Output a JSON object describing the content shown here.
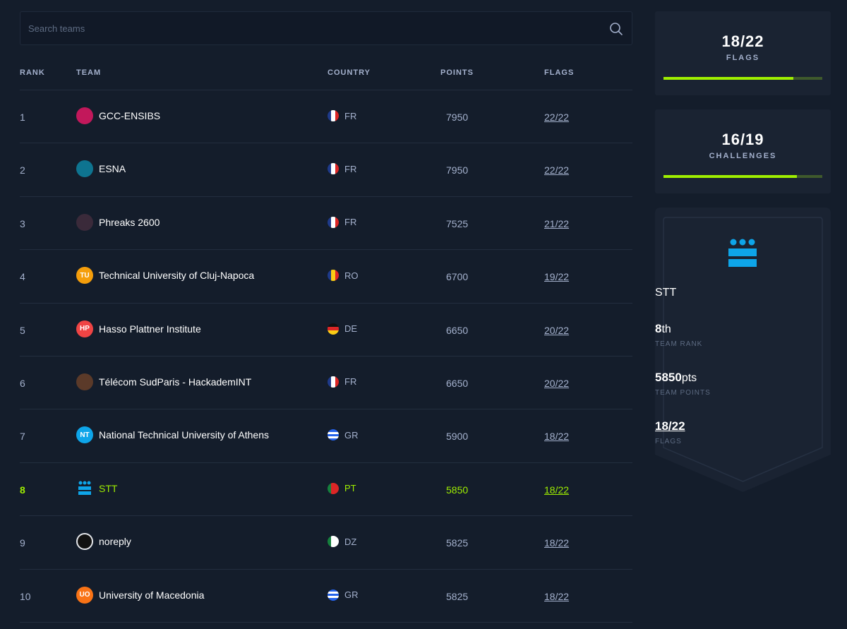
{
  "search": {
    "placeholder": "Search teams"
  },
  "table": {
    "headers": {
      "rank": "RANK",
      "team": "TEAM",
      "country": "COUNTRY",
      "points": "POINTS",
      "flags": "FLAGS"
    },
    "rows": [
      {
        "rank": "1",
        "team": "GCC-ENSIBS",
        "avatar_text": "",
        "avatar_color": "#c2185b",
        "country": "FR",
        "flag": "fr",
        "points": "7950",
        "flags": "22/22"
      },
      {
        "rank": "2",
        "team": "ESNA",
        "avatar_text": "",
        "avatar_color": "#0e7490",
        "country": "FR",
        "flag": "fr",
        "points": "7950",
        "flags": "22/22"
      },
      {
        "rank": "3",
        "team": "Phreaks 2600",
        "avatar_text": "",
        "avatar_color": "#3a2a3a",
        "country": "FR",
        "flag": "fr",
        "points": "7525",
        "flags": "21/22"
      },
      {
        "rank": "4",
        "team": "Technical University of Cluj-Napoca",
        "avatar_text": "TU",
        "avatar_color": "#f59e0b",
        "country": "RO",
        "flag": "ro",
        "points": "6700",
        "flags": "19/22"
      },
      {
        "rank": "5",
        "team": "Hasso Plattner Institute",
        "avatar_text": "HP",
        "avatar_color": "#ef4444",
        "country": "DE",
        "flag": "de",
        "points": "6650",
        "flags": "20/22"
      },
      {
        "rank": "6",
        "team": "Télécom SudParis - HackademINT",
        "avatar_text": "",
        "avatar_color": "#5b3a29",
        "country": "FR",
        "flag": "fr",
        "points": "6650",
        "flags": "20/22"
      },
      {
        "rank": "7",
        "team": "National Technical University of Athens",
        "avatar_text": "NT",
        "avatar_color": "#0ea5e9",
        "country": "GR",
        "flag": "gr",
        "points": "5900",
        "flags": "18/22"
      },
      {
        "rank": "8",
        "team": "STT",
        "avatar_text": "",
        "avatar_color": "stt",
        "country": "PT",
        "flag": "pt",
        "points": "5850",
        "flags": "18/22",
        "current": true
      },
      {
        "rank": "9",
        "team": "noreply",
        "avatar_text": "",
        "avatar_color": "#e5e7eb",
        "country": "DZ",
        "flag": "dz",
        "points": "5825",
        "flags": "18/22"
      },
      {
        "rank": "10",
        "team": "University of Macedonia",
        "avatar_text": "UO",
        "avatar_color": "#f97316",
        "country": "GR",
        "flag": "gr",
        "points": "5825",
        "flags": "18/22"
      }
    ]
  },
  "flags_card": {
    "value": "18/22",
    "label": "FLAGS",
    "progress": 0.818
  },
  "challenges_card": {
    "value": "16/19",
    "label": "CHALLENGES",
    "progress": 0.842
  },
  "team_badge": {
    "name": "STT",
    "rank_value": "8",
    "rank_suffix": "th",
    "rank_label": "TEAM RANK",
    "points_value": "5850",
    "points_suffix": "pts",
    "points_label": "TEAM POINTS",
    "flags_value": "18/22",
    "flags_label": "FLAGS"
  },
  "colors": {
    "accent": "#9fef00",
    "background": "#141d2b",
    "card": "#1a2332",
    "muted": "#a4b1cd",
    "logo": "#0ea5e9"
  }
}
